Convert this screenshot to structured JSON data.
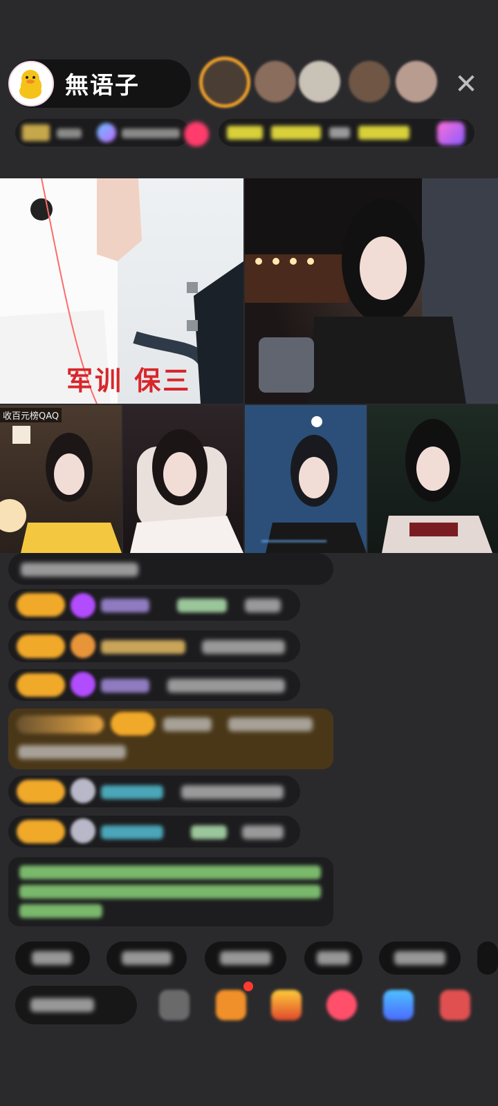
{
  "header": {
    "host_name": "無语子",
    "close_icon": "close-icon",
    "viewer_avatar_count": 5
  },
  "streams": {
    "main_left_caption": "军训  保三",
    "bottom_left_label": "收百元榜QAQ"
  },
  "colors": {
    "background": "#2a2a2d",
    "caption_red": "#d8262a",
    "badge_orange": "#f1a92a",
    "system_message": "#4a3718",
    "viewer_ring": "#f0a12a"
  }
}
